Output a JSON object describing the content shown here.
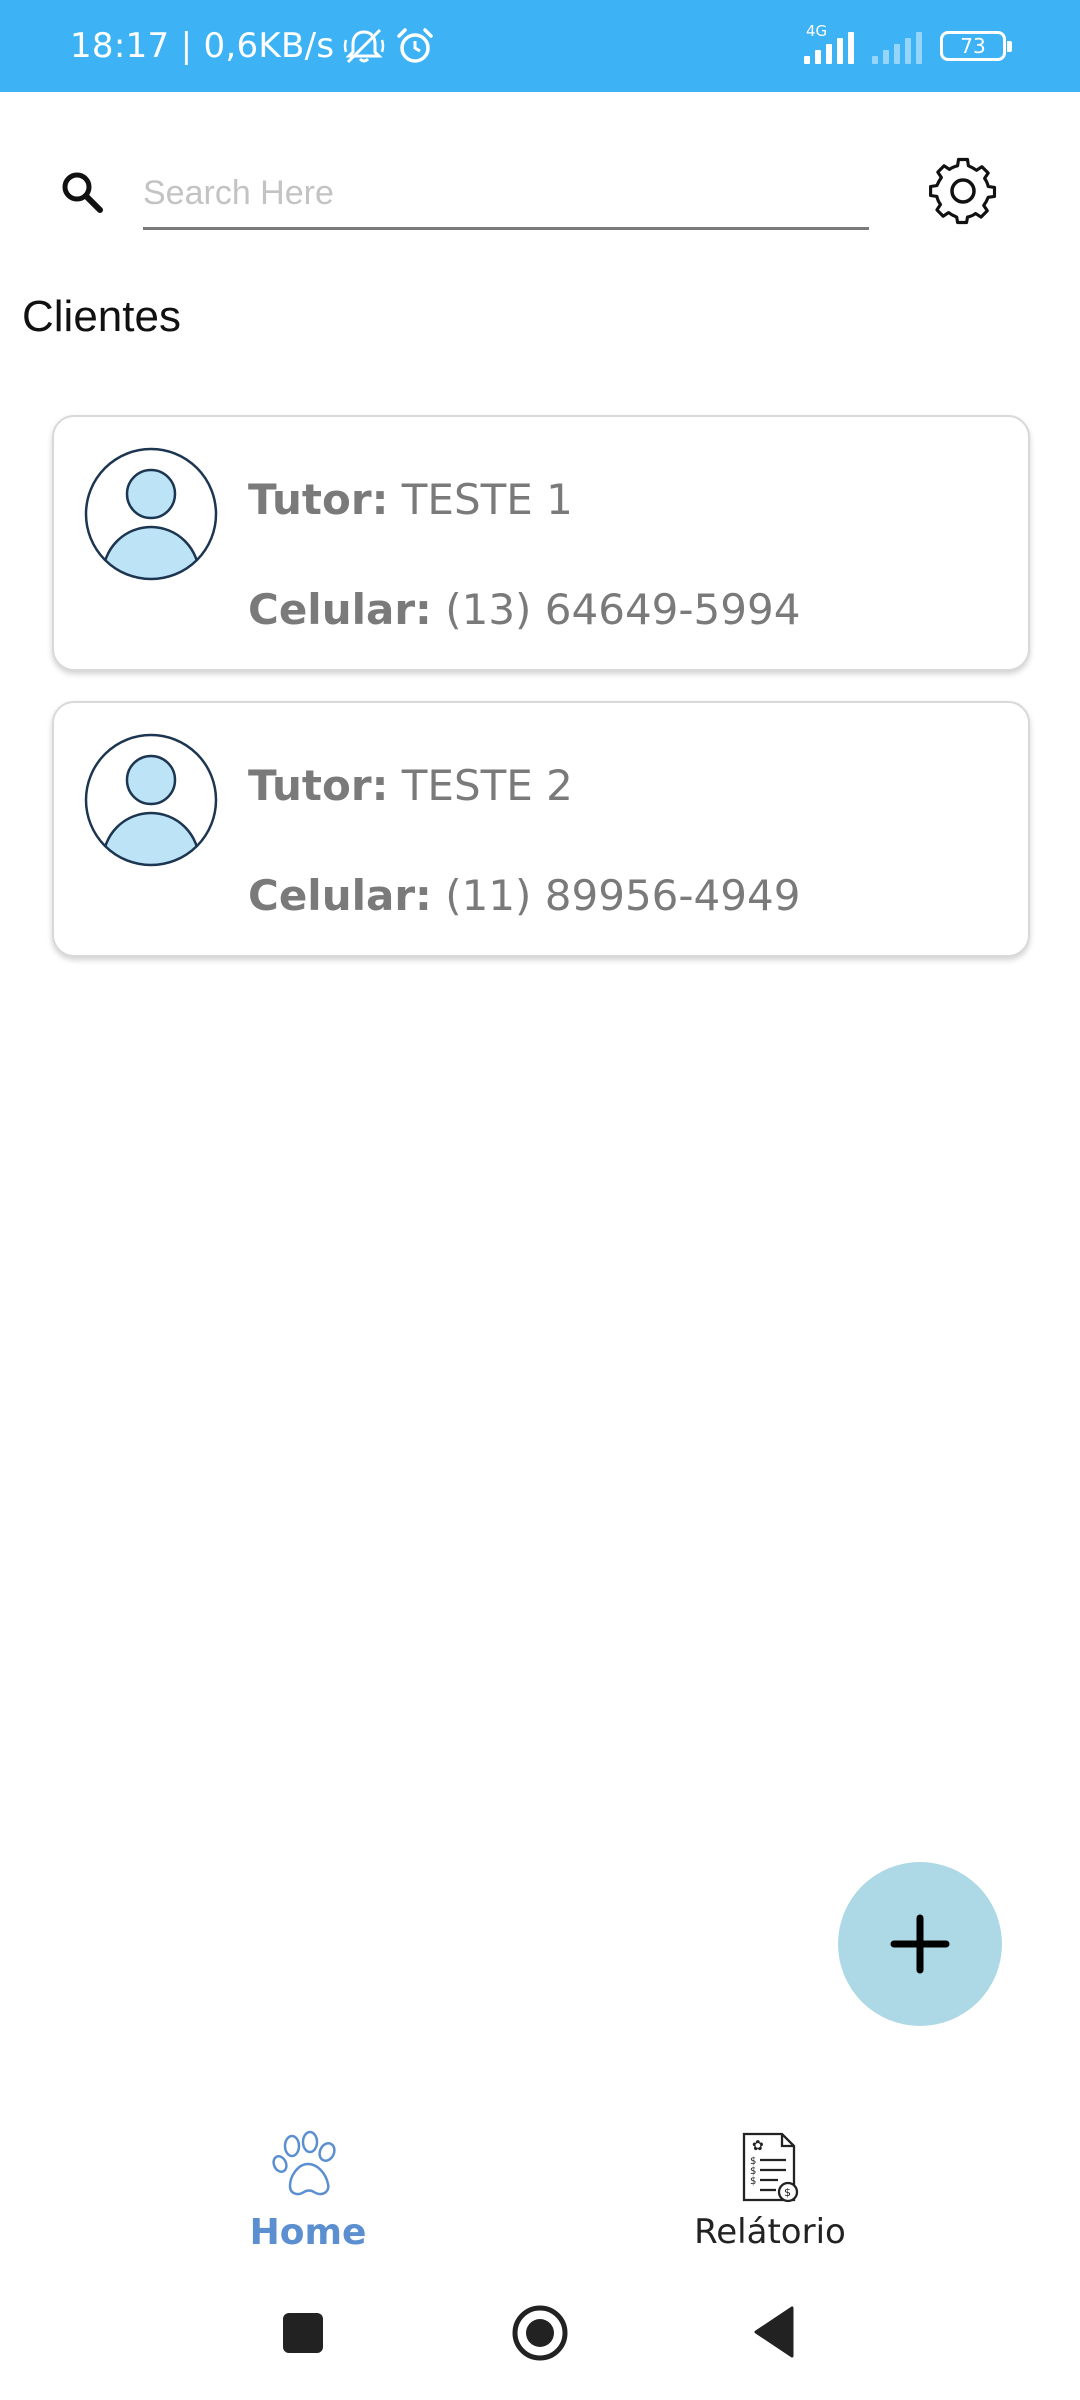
{
  "status_bar": {
    "time_speed": "18:17 | 0,6KB/s",
    "network_type": "4G",
    "battery": "73",
    "background_color": "#3db3f5",
    "icons": [
      "mute-icon",
      "alarm-icon",
      "signal-icon",
      "signal-weak-icon",
      "battery-icon"
    ]
  },
  "search": {
    "placeholder": "Search Here",
    "value": ""
  },
  "section": {
    "title": "Clientes"
  },
  "clients": [
    {
      "tutor_label": "Tutor:",
      "tutor_name": "TESTE 1",
      "phone_label": "Celular:",
      "phone": "(13) 64649-5994"
    },
    {
      "tutor_label": "Tutor:",
      "tutor_name": "TESTE 2",
      "phone_label": "Celular:",
      "phone": "(11) 89956-4949"
    }
  ],
  "fab": {
    "icon": "plus-icon",
    "color": "#add8e6"
  },
  "bottom_nav": {
    "home_label": "Home",
    "report_label": "Relátorio",
    "active_color": "#5b8fd0",
    "active": "Home"
  },
  "system_nav": {
    "icons": [
      "recent-apps-icon",
      "home-circle-icon",
      "back-triangle-icon"
    ]
  }
}
